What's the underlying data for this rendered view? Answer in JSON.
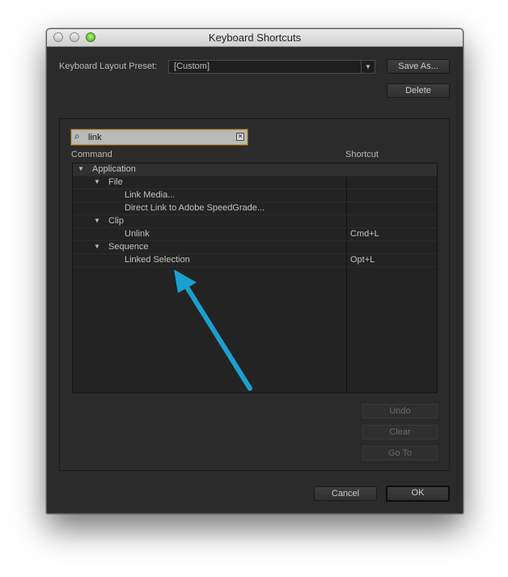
{
  "window": {
    "title": "Keyboard Shortcuts"
  },
  "preset": {
    "label": "Keyboard Layout Preset:",
    "value": "[Custom]"
  },
  "buttons": {
    "save_as": "Save As...",
    "delete": "Delete",
    "undo": "Undo",
    "clear": "Clear",
    "go_to": "Go To",
    "cancel": "Cancel",
    "ok": "OK"
  },
  "search": {
    "value": "link"
  },
  "columns": {
    "command": "Command",
    "shortcut": "Shortcut"
  },
  "rows": [
    {
      "name": "Application",
      "shortcut": "",
      "expanded": true
    },
    {
      "name": "File",
      "shortcut": "",
      "expanded": true
    },
    {
      "name": "Link Media...",
      "shortcut": ""
    },
    {
      "name": "Direct Link to Adobe SpeedGrade...",
      "shortcut": ""
    },
    {
      "name": "Clip",
      "shortcut": "",
      "expanded": true
    },
    {
      "name": "Unlink",
      "shortcut": "Cmd+L"
    },
    {
      "name": "Sequence",
      "shortcut": "",
      "expanded": true
    },
    {
      "name": "Linked Selection",
      "shortcut": "Opt+L"
    }
  ],
  "annotation": {
    "color": "#1aa0cf",
    "icon": "arrow-icon"
  }
}
